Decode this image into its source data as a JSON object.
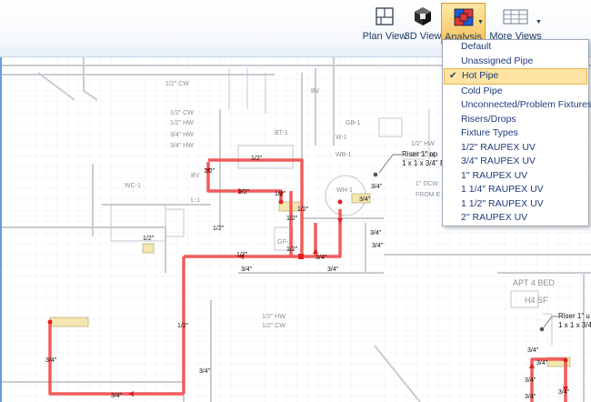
{
  "colors": {
    "accent": "#f7c25c",
    "hot_pipe": "#f25b5b",
    "menu_text": "#1f3a7a"
  },
  "toolbar": {
    "plan_view": {
      "label": "Plan View",
      "icon": "plan-view-icon"
    },
    "view_3d": {
      "label": "3D View",
      "icon": "cube-3d-icon"
    },
    "analysis": {
      "label": "Analysis",
      "icon": "analysis-icon"
    },
    "more_views": {
      "label": "More Views",
      "icon": "grid-views-icon"
    }
  },
  "analysis_menu": {
    "selected": "Hot Pipe",
    "items": [
      "Default",
      "Unassigned Pipe",
      "Hot Pipe",
      "Cold Pipe",
      "Unconnected/Problem Fixtures",
      "Risers/Drops",
      "Fixture Types",
      "1/2\" RAUPEX UV",
      "3/4\" RAUPEX UV",
      "1\" RAUPEX UV",
      "1 1/4\" RAUPEX UV",
      "1 1/2\" RAUPEX UV",
      "2\" RAUPEX UV"
    ]
  },
  "drawing": {
    "background_labels": {
      "cw_1": "1/2\" CW",
      "cw_2": "1/2\" CW",
      "hw_1": "1/2\" HW",
      "hw_2": "3/4\" HW",
      "hw_3": "3/4\" HW",
      "bv_1": "BV",
      "bt_1": "BT-1",
      "gb_1": "GB-1",
      "w_1": "W-1",
      "wb_1": "WB-1",
      "wc_1": "WC-1",
      "l_1": "L-1",
      "bv_2": "BV",
      "wh_1": "WH-1",
      "gf_1": "GF-1",
      "hw_4": "1/2\" HW",
      "cw_3": "1/2\" CW",
      "dcw": "1\" DCW",
      "from_e": "FROM E",
      "riser_1a": "Riser 1\" up",
      "riser_1b": "1 x 1 x 3/4\" E",
      "apt": "APT 4 BED",
      "h4sf": "H4 SF",
      "riser_2a": "Riser 1\" u",
      "riser_2b": "1 x 1 x 3/4\"",
      "hw_5": "1/2\" HW",
      "cw_4": "1/2\" CW"
    },
    "pipe_labels": {
      "p1": "1/2\"",
      "p2": "1/2\"",
      "p3": "1/2\"",
      "p4": "1/2\"",
      "p5": "1/2\"",
      "p6": "1/2\"",
      "p7": "1/2\"",
      "p8": "1/2\"",
      "p9": "1/2\"",
      "p10": "1/2\"",
      "p11": "3/4\"",
      "p12": "3/4\"",
      "p13": "3/4\"",
      "p14": "3/4\"",
      "p15": "3/4\"",
      "p16": "3/4\"",
      "p17": "3/4\"",
      "p18": "1/2\"",
      "p19": "3/4\"",
      "p20": "3/4\"",
      "p21": "3/4\"",
      "p22": "3/4\"",
      "p23": "3/4\"",
      "p24": "3/4\"",
      "p25": "3/4\"",
      "p26": "3/4\""
    }
  }
}
